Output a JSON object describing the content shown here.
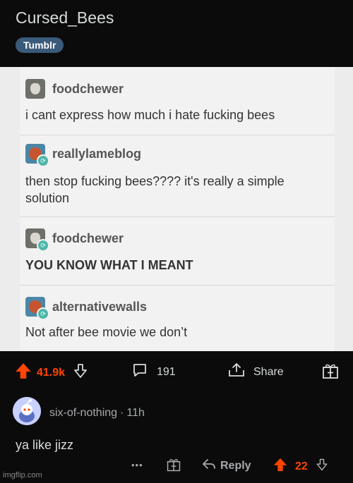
{
  "post": {
    "title": "Cursed_Bees",
    "flair": "Tumblr"
  },
  "tumblr": [
    {
      "user": "foodchewer",
      "text": "i cant express how much i hate fucking bees",
      "avatar": "dog-avatar",
      "reblog": false
    },
    {
      "user": "reallylameblog",
      "text": "then stop fucking bees???? it's really a simple solution",
      "avatar": "ball-avatar",
      "reblog": true
    },
    {
      "user": "foodchewer",
      "text": "YOU KNOW WHAT I MEANT",
      "avatar": "dog-avatar",
      "reblog": true
    },
    {
      "user": "alternativewalls",
      "text": "Not after bee movie we don’t",
      "avatar": "ball-avatar",
      "reblog": true
    }
  ],
  "actions": {
    "upvotes": "41.9k",
    "comments": "191",
    "share": "Share"
  },
  "comment": {
    "author": "six-of-nothing",
    "age": "11h",
    "body": "ya like jizz",
    "more": "•••",
    "reply": "Reply",
    "score": "22"
  },
  "watermark": "imgflip.com",
  "colors": {
    "accent": "#ff4500",
    "flair": "#3a5a7a",
    "background": "#0b0b0b"
  }
}
